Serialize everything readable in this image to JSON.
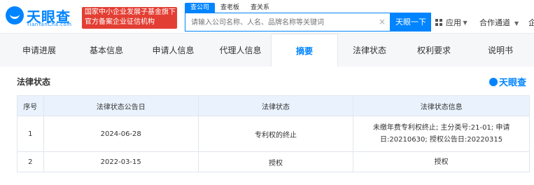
{
  "header": {
    "logo_text": "天眼查",
    "logo_domain": "TianYanCha.com",
    "banner_line1": "国家中小企业发展子基金旗下",
    "banner_line2": "官方备案企业征信机构",
    "search_tabs": [
      "查公司",
      "查老板",
      "查关系"
    ],
    "search_placeholder": "请输入公司名称、人名、品牌名称等关键词",
    "search_button": "天眼一下",
    "nav_apps": "应用",
    "nav_cooperate": "合作通道",
    "nav_enterprise": "企"
  },
  "tabs": [
    "申请进展",
    "基本信息",
    "申请人信息",
    "代理人信息",
    "摘要",
    "法律状态",
    "权利要求",
    "说明书"
  ],
  "active_tab_index": 4,
  "panel": {
    "title": "法律状态",
    "watermark": "天眼查"
  },
  "table": {
    "headers": [
      "序号",
      "法律状态公告日",
      "法律状态",
      "法律状态信息"
    ],
    "rows": [
      {
        "index": "1",
        "date": "2024-06-28",
        "status": "专利权的终止",
        "info_line1": "未缴年费专利权终止; 主分类号:21-01; 申请",
        "info_line2": "日:20210630; 授权公告日:20220315"
      },
      {
        "index": "2",
        "date": "2022-03-15",
        "status": "授权",
        "info_line1": "授权",
        "info_line2": ""
      }
    ]
  },
  "colors": {
    "brand_blue": "#0084ff",
    "banner_red": "#e33e33",
    "table_header_bg": "#eaf3fd"
  }
}
